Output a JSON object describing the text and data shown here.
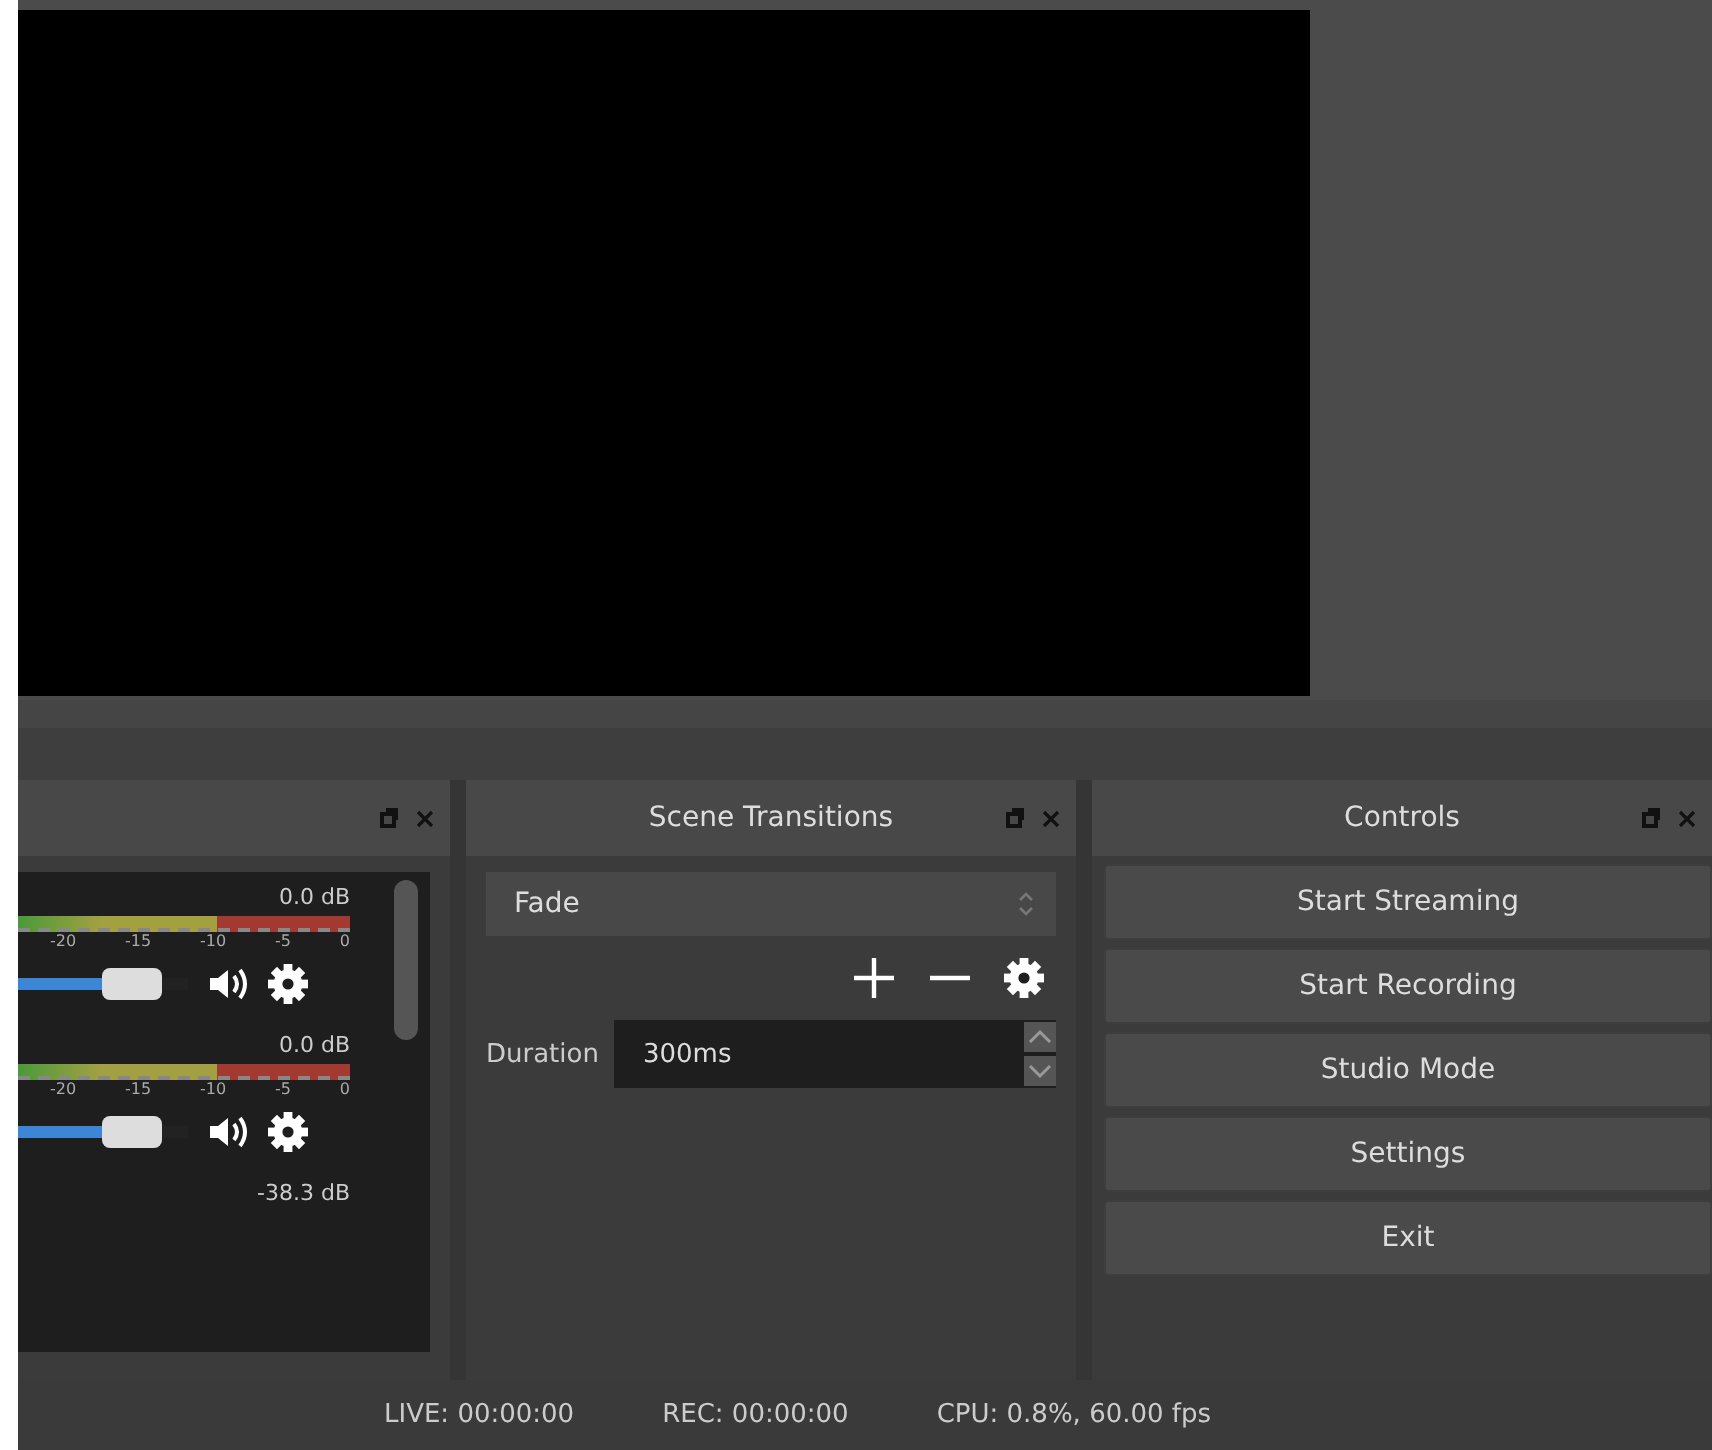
{
  "mixer": {
    "channels": [
      {
        "reading": "0.0 dB",
        "ticks": [
          "-20",
          "-15",
          "-10",
          "-5",
          "0"
        ],
        "level": 0.85
      },
      {
        "reading": "0.0 dB",
        "ticks": [
          "-20",
          "-15",
          "-10",
          "-5",
          "0"
        ],
        "level": 0.85
      },
      {
        "reading": "-38.3 dB"
      }
    ]
  },
  "transitions": {
    "title": "Scene Transitions",
    "transition": "Fade",
    "duration_label": "Duration",
    "duration": "300ms"
  },
  "controls": {
    "title": "Controls",
    "buttons": [
      "Start Streaming",
      "Start Recording",
      "Studio Mode",
      "Settings",
      "Exit"
    ]
  },
  "status_bar": {
    "live": "LIVE: 00:00:00",
    "rec": "REC: 00:00:00",
    "cpu": "CPU: 0.8%, 60.00 fps"
  }
}
